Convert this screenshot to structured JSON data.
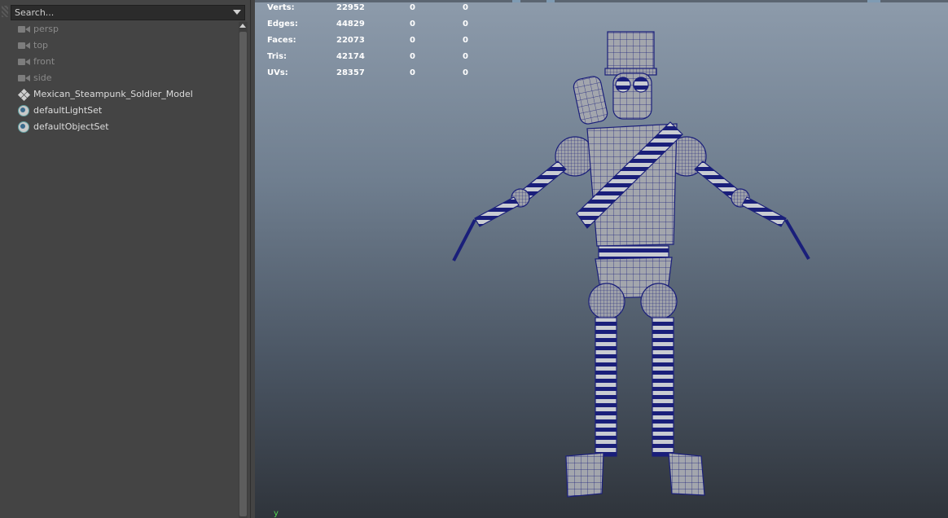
{
  "outliner": {
    "search_placeholder": "Search...",
    "items": [
      {
        "label": "persp",
        "icon": "camera-icon",
        "dim": true
      },
      {
        "label": "top",
        "icon": "camera-icon",
        "dim": true
      },
      {
        "label": "front",
        "icon": "camera-icon",
        "dim": true
      },
      {
        "label": "side",
        "icon": "camera-icon",
        "dim": true
      },
      {
        "label": "Mexican_Steampunk_Soldier_Model",
        "icon": "transform-group-icon",
        "dim": false
      },
      {
        "label": "defaultLightSet",
        "icon": "set-icon",
        "dim": false
      },
      {
        "label": "defaultObjectSet",
        "icon": "set-icon",
        "dim": false
      }
    ]
  },
  "viewport": {
    "hud": [
      {
        "label": "Verts:",
        "values": [
          "22952",
          "0",
          "0"
        ]
      },
      {
        "label": "Edges:",
        "values": [
          "44829",
          "0",
          "0"
        ]
      },
      {
        "label": "Faces:",
        "values": [
          "22073",
          "0",
          "0"
        ]
      },
      {
        "label": "Tris:",
        "values": [
          "42174",
          "0",
          "0"
        ]
      },
      {
        "label": "UVs:",
        "values": [
          "28357",
          "0",
          "0"
        ]
      }
    ],
    "axis_label": "y",
    "colors": {
      "wireframe": "#1a1f7a",
      "mesh_fill": "#a3a6ad",
      "axis": "#51d851"
    }
  }
}
